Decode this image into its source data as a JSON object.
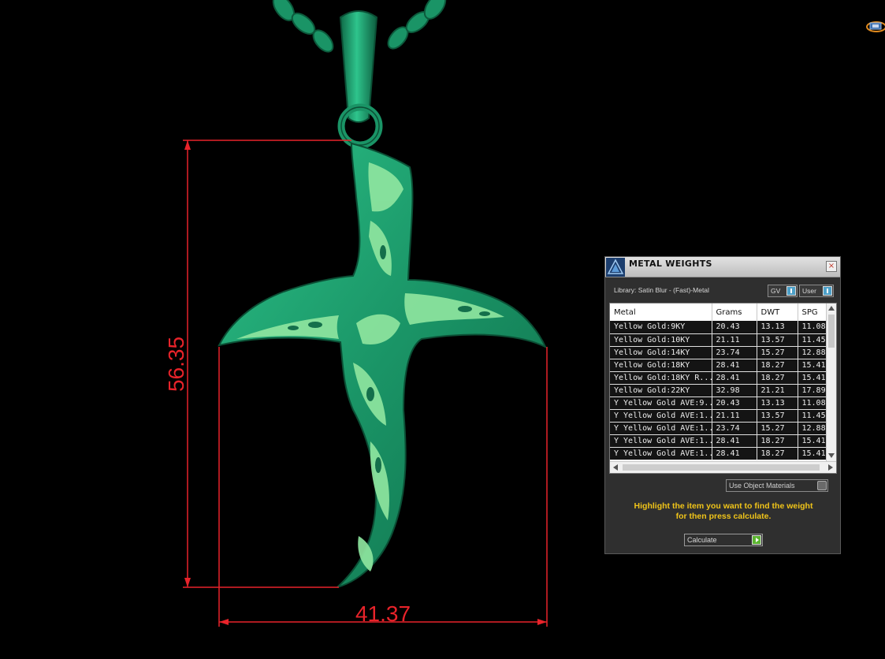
{
  "dimensions": {
    "height_label": "56.35",
    "width_label": "41.37",
    "color": "#e8232a"
  },
  "model": {
    "main_color": "#1f9e6d",
    "highlight_color": "#8ee59f"
  },
  "panel": {
    "title": "METAL WEIGHTS",
    "close_label": "×",
    "library_label": "Library: Satin Blur - (Fast)-Metal",
    "gv_label": "GV",
    "user_label": "User",
    "columns": [
      "Metal",
      "Grams",
      "DWT",
      "SPG"
    ],
    "rows": [
      {
        "metal": "Yellow Gold:9KY",
        "grams": "20.43",
        "dwt": "13.13",
        "spg": "11.08"
      },
      {
        "metal": "Yellow Gold:10KY",
        "grams": "21.11",
        "dwt": "13.57",
        "spg": "11.45"
      },
      {
        "metal": "Yellow Gold:14KY",
        "grams": "23.74",
        "dwt": "15.27",
        "spg": "12.88"
      },
      {
        "metal": "Yellow Gold:18KY",
        "grams": "28.41",
        "dwt": "18.27",
        "spg": "15.41"
      },
      {
        "metal": "Yellow Gold:18KY R...",
        "grams": "28.41",
        "dwt": "18.27",
        "spg": "15.41"
      },
      {
        "metal": "Yellow Gold:22KY",
        "grams": "32.98",
        "dwt": "21.21",
        "spg": "17.89"
      },
      {
        "metal": "Y Yellow Gold AVE:9...",
        "grams": "20.43",
        "dwt": "13.13",
        "spg": "11.08"
      },
      {
        "metal": "Y Yellow Gold AVE:1...",
        "grams": "21.11",
        "dwt": "13.57",
        "spg": "11.45"
      },
      {
        "metal": "Y Yellow Gold AVE:1...",
        "grams": "23.74",
        "dwt": "15.27",
        "spg": "12.88"
      },
      {
        "metal": "Y Yellow Gold AVE:1...",
        "grams": "28.41",
        "dwt": "18.27",
        "spg": "15.41"
      },
      {
        "metal": "Y Yellow Gold AVE:1...",
        "grams": "28.41",
        "dwt": "18.27",
        "spg": "15.41"
      }
    ],
    "use_materials_label": "Use Object Materials",
    "instructions_line1": "Highlight the item you want to find the weight",
    "instructions_line2": "for then press calculate.",
    "calculate_label": "Calculate",
    "accent_color": "#f0c419"
  }
}
